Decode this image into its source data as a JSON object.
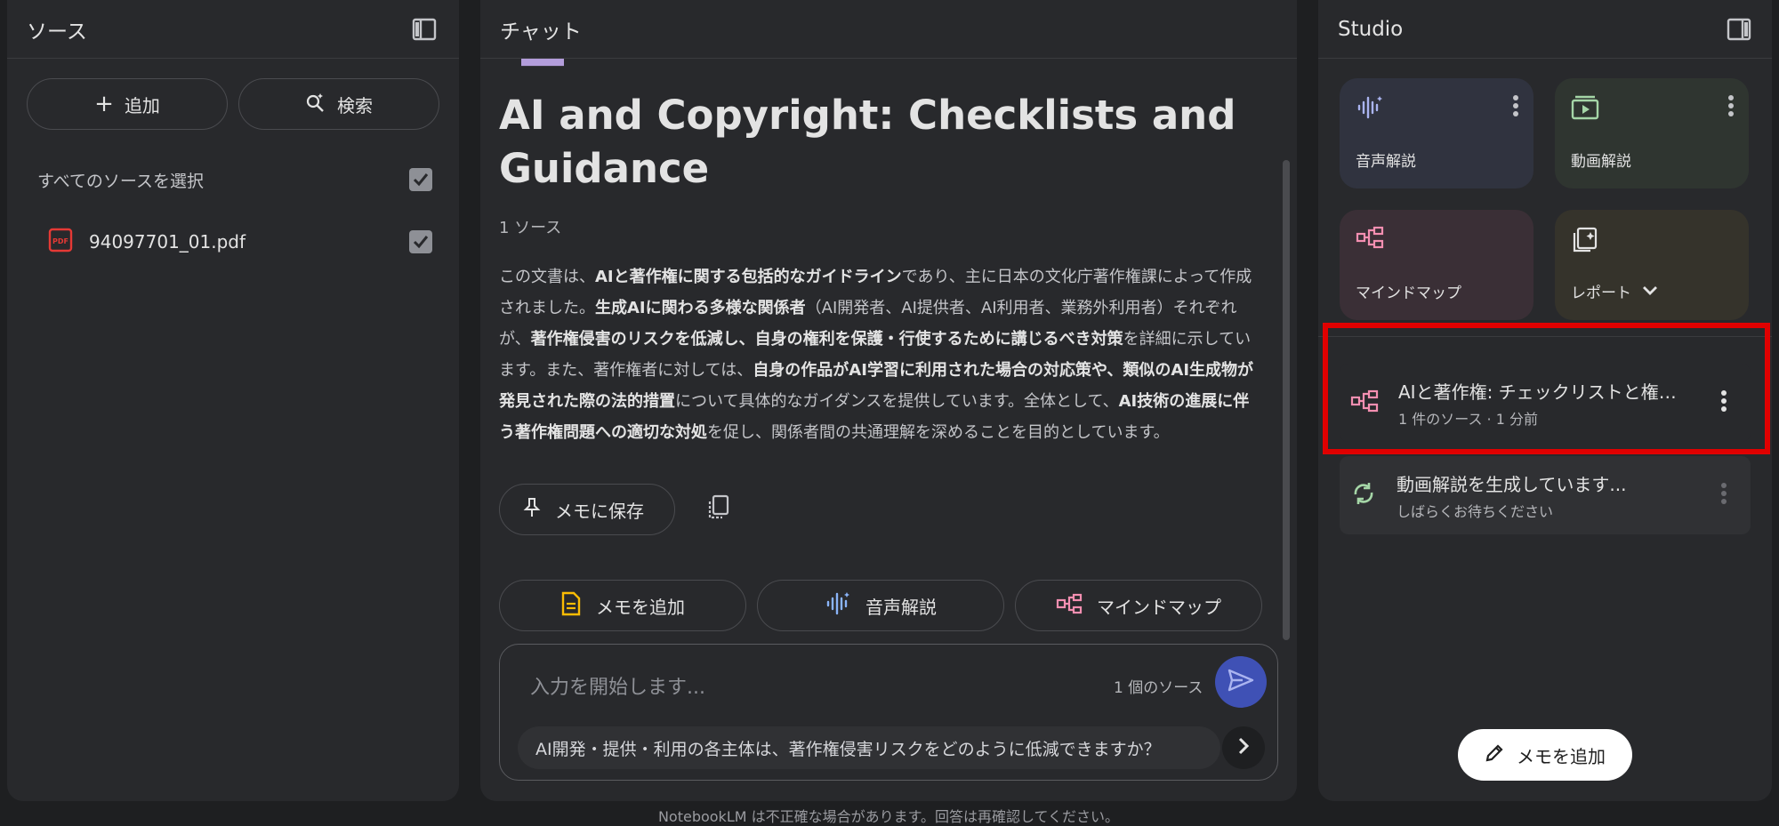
{
  "sources": {
    "title": "ソース",
    "add_label": "追加",
    "search_label": "検索",
    "select_all_label": "すべてのソースを選択",
    "files": [
      {
        "name": "94097701_01.pdf",
        "checked": true
      }
    ]
  },
  "chat": {
    "title": "チャット",
    "doc_title": "AI and Copyright: Checklists and Guidance",
    "source_count": "1 ソース",
    "summary": {
      "p1": "この文書は、",
      "b1": "AIと著作権に関する包括的なガイドライン",
      "p2": "であり、主に日本の文化庁著作権課によって作成されました。",
      "b2": "生成AIに関わる多様な関係者",
      "p3": "（AI開発者、AI提供者、AI利用者、業務外利用者）それぞれが、",
      "b3": "著作権侵害のリスクを低減し、自身の権利を保護・行使するために講じるべき対策",
      "p4": "を詳細に示しています。また、著作権者に対しては、",
      "b4": "自身の作品がAI学習に利用された場合の対応策や、類似のAI生成物が発見された際の法的措置",
      "p5": "について具体的なガイダンスを提供しています。全体として、",
      "b5": "AI技術の進展に伴う著作権問題への適切な対処",
      "p6": "を促し、関係者間の共通理解を深めることを目的としています。"
    },
    "save_note_label": "メモに保存",
    "actions": [
      {
        "label": "メモを追加"
      },
      {
        "label": "音声解説"
      },
      {
        "label": "マインドマップ"
      }
    ],
    "input_placeholder": "入力を開始します...",
    "composer_source_count": "1 個のソース",
    "suggestion": "AI開発・提供・利用の各主体は、著作権侵害リスクをどのように低減できますか？",
    "footer_note": "NotebookLM は不正確な場合があります。回答は再確認してください。"
  },
  "studio": {
    "title": "Studio",
    "tiles": [
      {
        "label": "音声解説",
        "color": "#30333f"
      },
      {
        "label": "動画解説",
        "color": "#2f3530"
      },
      {
        "label": "マインドマップ",
        "color": "#3a2f36"
      },
      {
        "label": "レポート",
        "color": "#35332b"
      }
    ],
    "notes": [
      {
        "title": "AIと著作権: チェックリストと権利保護...",
        "sub": "1 件のソース · 1 分前"
      },
      {
        "title": "動画解説を生成しています...",
        "sub": "しばらくお待ちください"
      }
    ],
    "add_note_label": "メモを追加",
    "colors": {
      "accent_blue": "#3f51b5",
      "highlight_red": "#e00000",
      "pdf_red": "#e53935"
    }
  }
}
